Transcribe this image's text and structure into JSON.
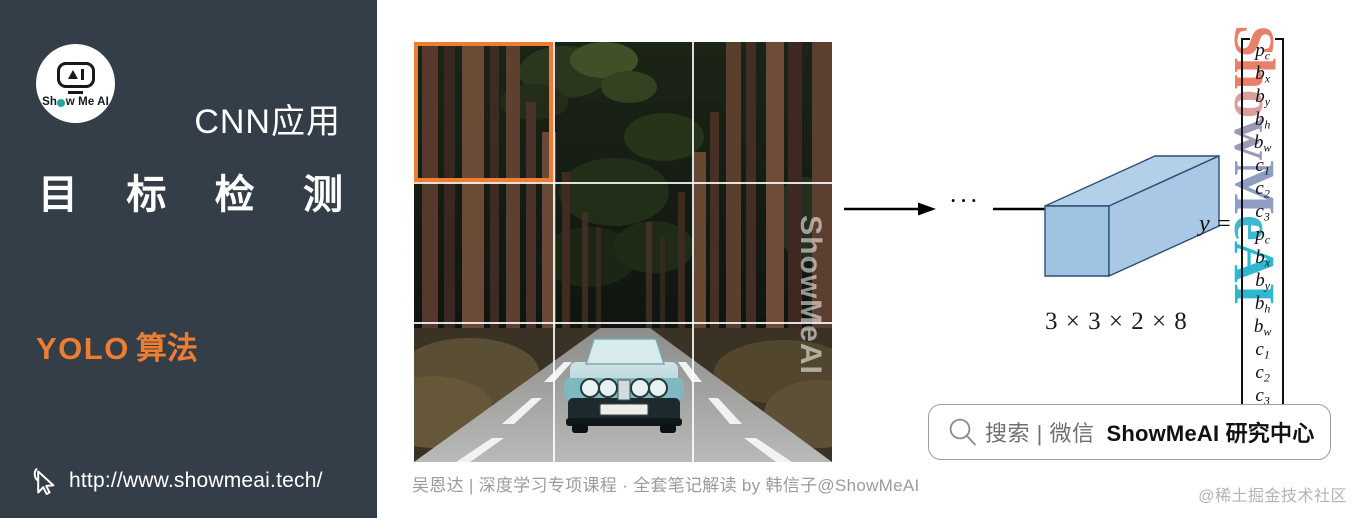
{
  "sidebar": {
    "logo": {
      "icon": "robot-face-icon",
      "text_before": "Sh",
      "text_after": "w Me AI"
    },
    "kicker": "CNN应用",
    "title_chars": [
      "目",
      "标",
      "检",
      "测"
    ],
    "subtitle_latin": "YOLO",
    "subtitle_cn": "算法",
    "url": "http://www.showmeai.tech/",
    "cursor_icon": "mouse-pointer-icon",
    "bg_color": "#343e48",
    "accent_color": "#ed7d31"
  },
  "main": {
    "photo": {
      "alt_description": "森林公路上的浅蓝色老爷车",
      "grid": "3 x 3",
      "highlight_cell": "row1-col1",
      "highlight_color": "#ed7d31",
      "watermark": "ShowMeAI"
    },
    "caption": "吴恩达 | 深度学习专项课程 · 全套笔记解读  by 韩信子@ShowMeAI",
    "flow": {
      "arrow_1": "arrow-right-icon",
      "ellipsis": "···",
      "arrow_2": "arrow-right-icon"
    },
    "cube": {
      "icon": "3d-volume-icon",
      "label": "3 × 3 × 2 × 8",
      "fill_color": "#a8c6e5"
    },
    "vector": {
      "lhs": "y =",
      "items": [
        "p",
        "b",
        "b",
        "b",
        "b",
        "c",
        "c",
        "c",
        "p",
        "b",
        "b",
        "b",
        "b",
        "c",
        "c",
        "c"
      ],
      "subs": [
        "c",
        "x",
        "y",
        "h",
        "w",
        "1",
        "2",
        "3",
        "c",
        "x",
        "y",
        "h",
        "w",
        "1",
        "2",
        "3"
      ]
    },
    "brand_watermark": {
      "letters": [
        "S",
        "h",
        "o",
        "w",
        "M",
        "e",
        "A",
        "I"
      ]
    },
    "search": {
      "icon": "search-icon",
      "label": "搜索 | 微信",
      "brand": "ShowMeAI 研究中心"
    },
    "corner_watermark": "@稀土掘金技术社区"
  }
}
